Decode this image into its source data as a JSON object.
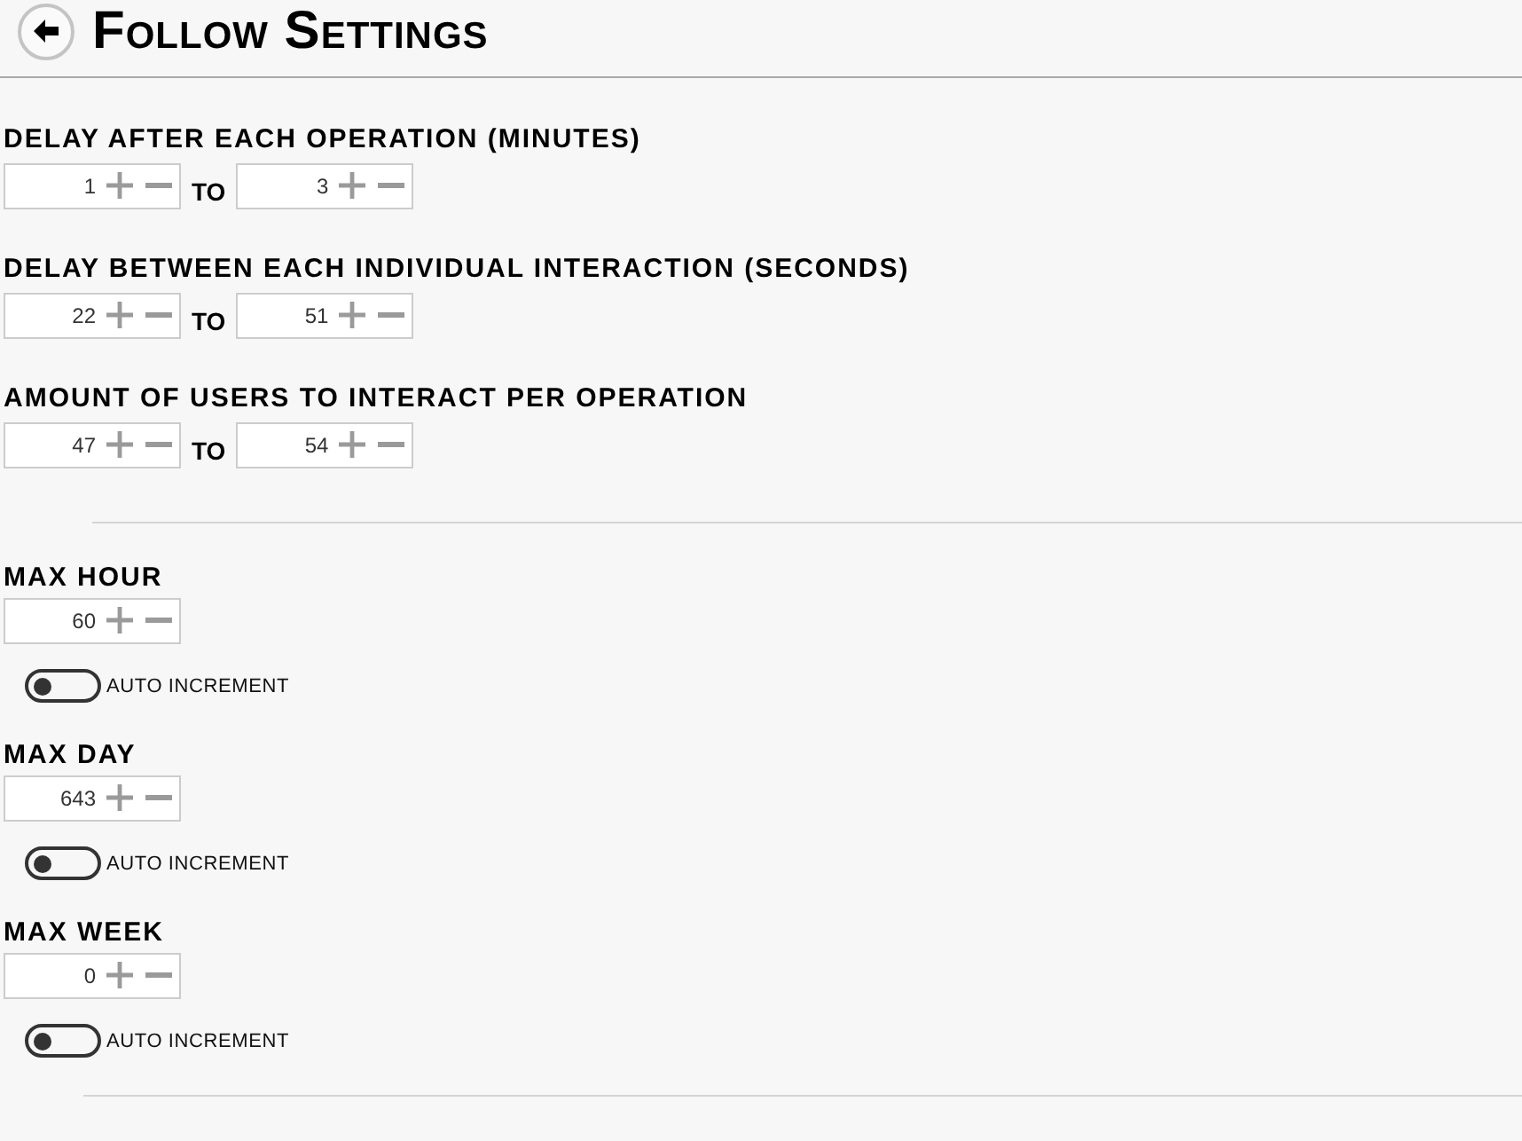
{
  "header": {
    "title": "Follow Settings"
  },
  "ranges": [
    {
      "label": "DELAY AFTER EACH OPERATION (MINUTES)",
      "from": "1",
      "separator": "TO",
      "to": "3"
    },
    {
      "label": "DELAY BETWEEN EACH INDIVIDUAL INTERACTION (SECONDS)",
      "from": "22",
      "separator": "TO",
      "to": "51"
    },
    {
      "label": "AMOUNT OF USERS TO INTERACT PER OPERATION",
      "from": "47",
      "separator": "TO",
      "to": "54"
    }
  ],
  "limits": [
    {
      "label": "MAX HOUR",
      "value": "60",
      "auto_increment": {
        "label": "AUTO INCREMENT",
        "on": false
      }
    },
    {
      "label": "MAX DAY",
      "value": "643",
      "auto_increment": {
        "label": "AUTO INCREMENT",
        "on": false
      }
    },
    {
      "label": "MAX WEEK",
      "value": "0",
      "auto_increment": {
        "label": "AUTO INCREMENT",
        "on": false
      }
    }
  ]
}
